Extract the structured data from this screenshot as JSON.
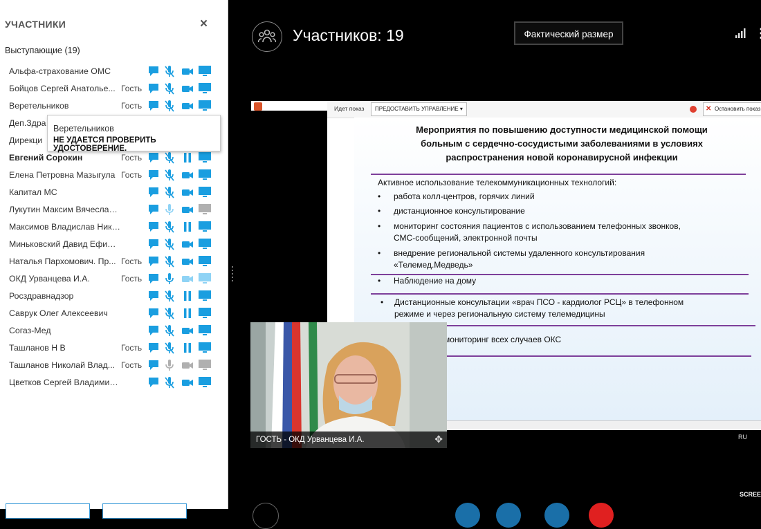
{
  "panel": {
    "title": "УЧАСТНИКИ",
    "close": "×",
    "section": "Выступающие (19)"
  },
  "participants": [
    {
      "name": "Альфа-страхование ОМС",
      "role": "",
      "bold": false,
      "mic": "muted",
      "cam": "on",
      "screen": "on"
    },
    {
      "name": "Бойцов Сергей Анатолье...",
      "role": "Гость",
      "bold": false,
      "mic": "muted",
      "cam": "on",
      "screen": "on"
    },
    {
      "name": "Веретельников",
      "role": "Гость",
      "bold": false,
      "mic": "muted",
      "cam": "on",
      "screen": "on"
    },
    {
      "name": "Деп.Здра",
      "role": "",
      "bold": false,
      "mic": "muted",
      "cam": "on",
      "screen": "on"
    },
    {
      "name": "Дирекци",
      "role": "",
      "bold": false,
      "mic": "muted",
      "cam": "on",
      "screen": "on"
    },
    {
      "name": "Евгений Сорокин",
      "role": "Гость",
      "bold": true,
      "mic": "muted",
      "cam": "paused",
      "screen": "on"
    },
    {
      "name": "Елена Петровна Мазыгула",
      "role": "Гость",
      "bold": false,
      "mic": "muted",
      "cam": "on",
      "screen": "on"
    },
    {
      "name": "Капитал МС",
      "role": "",
      "bold": false,
      "mic": "muted",
      "cam": "on",
      "screen": "on"
    },
    {
      "name": "Лукутин Максим Вячеславович",
      "role": "",
      "bold": false,
      "mic": "light",
      "cam": "on",
      "screen": "off"
    },
    {
      "name": "Максимов Владислав Николаев...",
      "role": "",
      "bold": false,
      "mic": "muted",
      "cam": "paused",
      "screen": "on"
    },
    {
      "name": "Миньковский Давид Ефимович",
      "role": "",
      "bold": false,
      "mic": "muted",
      "cam": "on",
      "screen": "on"
    },
    {
      "name": "Наталья Пархомович. Пр...",
      "role": "Гость",
      "bold": false,
      "mic": "muted",
      "cam": "on",
      "screen": "on"
    },
    {
      "name": "ОКД Урванцева И.А.",
      "role": "Гость",
      "bold": false,
      "mic": "on",
      "cam": "light",
      "screen": "light"
    },
    {
      "name": "Росздравнадзор",
      "role": "",
      "bold": false,
      "mic": "muted",
      "cam": "paused",
      "screen": "on"
    },
    {
      "name": "Саврук Олег Алексеевич",
      "role": "",
      "bold": false,
      "mic": "muted",
      "cam": "paused",
      "screen": "on"
    },
    {
      "name": "Согаз-Мед",
      "role": "",
      "bold": false,
      "mic": "muted",
      "cam": "on",
      "screen": "on"
    },
    {
      "name": "Ташланов Н В",
      "role": "Гость",
      "bold": false,
      "mic": "muted",
      "cam": "paused",
      "screen": "on"
    },
    {
      "name": "Ташланов Николай Влад...",
      "role": "Гость",
      "bold": false,
      "mic": "off",
      "cam": "off",
      "screen": "off"
    },
    {
      "name": "Цветков Сергей Владимирович",
      "role": "",
      "bold": false,
      "mic": "muted",
      "cam": "on",
      "screen": "on"
    }
  ],
  "tooltip": {
    "name": "Веретельников",
    "message": "НЕ УДАЕТСЯ ПРОВЕРИТЬ УДОСТОВЕРЕНИЕ."
  },
  "header": {
    "participants_count": "Участников: 19",
    "size_button": "Фактический размер"
  },
  "share_toolbar": {
    "status": "Идет показ",
    "control_button": "ПРЕДОСТАВИТЬ УПРАВЛЕНИЕ ▾",
    "stop_button": "Остановить показ"
  },
  "slide": {
    "title_lines": [
      "Мероприятия по повышению доступности медицинской помощи",
      "больным с сердечно-сосудистыми заболеваниями в условиях",
      "распространения новой коронавирусной инфекции"
    ],
    "intro": "Активное использование телекоммуникационных технологий:",
    "bullets_1": [
      "работа колл-центров, горячих линий",
      "дистанционное консультирование",
      "мониторинг состояния пациентов с использованием телефонных звонков,",
      "СМС-сообщений, электронной почты",
      "внедрение региональной системы удаленного консультирования",
      "«Телемед.Медведь»"
    ],
    "item_2": "Наблюдение на дому",
    "item_3_lines": [
      "Дистанционные консультации «врач ПСО - кардиолог РСЦ» в телефонном",
      "режиме и через региональную систему телемедицины"
    ],
    "item_4": "й мониторинг всех случаев ОКС"
  },
  "video": {
    "caption": "ГОСТЬ - ОКД Урванцева И.А."
  },
  "lang": "RU",
  "screen_label": "SCREE",
  "colors": {
    "icon_blue": "#1a9ee0",
    "icon_light": "#8fd3f5",
    "icon_gray": "#b0b0b0",
    "slide_line": "#7d3f9a"
  }
}
